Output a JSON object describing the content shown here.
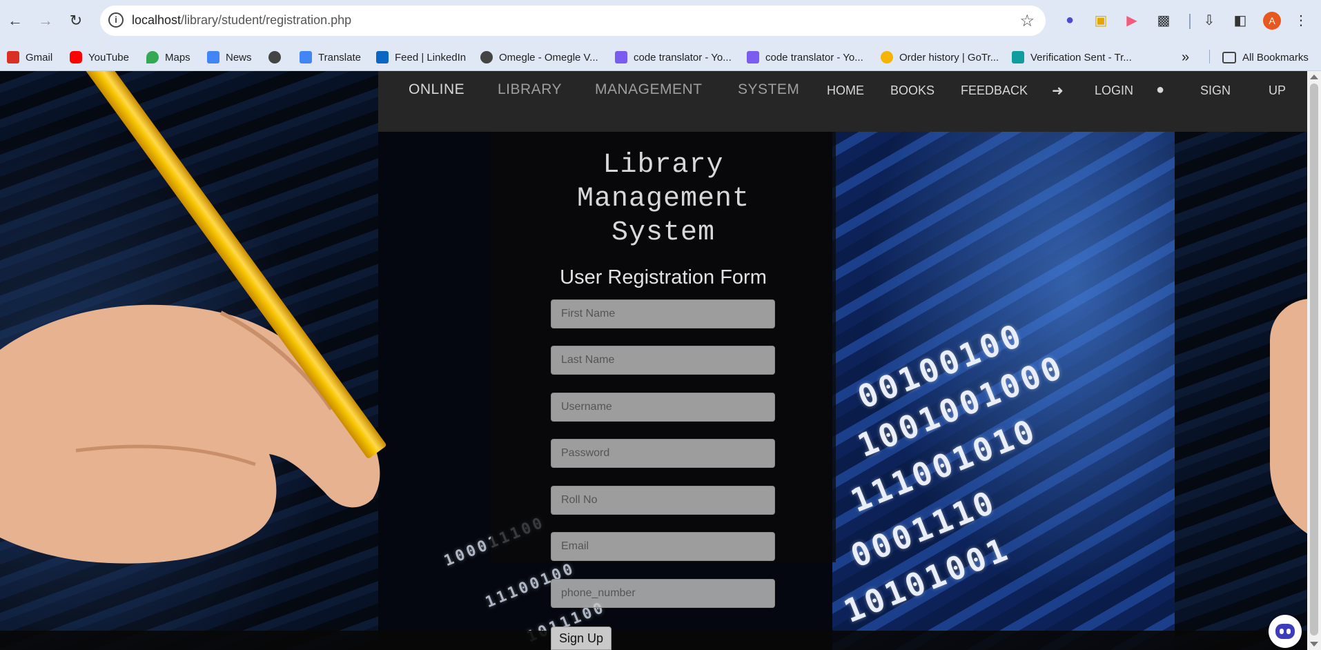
{
  "browser": {
    "url_host": "localhost",
    "url_path": "/library/student/registration.php",
    "profile_initial": "A",
    "bookmarks": [
      {
        "label": "Gmail",
        "icon": "gmail-icon",
        "color": "#d93025"
      },
      {
        "label": "YouTube",
        "icon": "youtube-icon",
        "color": "#ff0000"
      },
      {
        "label": "Maps",
        "icon": "maps-icon",
        "color": "#34a853"
      },
      {
        "label": "News",
        "icon": "news-icon",
        "color": "#4285f4"
      },
      {
        "label": "",
        "icon": "globe-icon",
        "color": "#333333"
      },
      {
        "label": "Translate",
        "icon": "translate-icon",
        "color": "#4285f4"
      },
      {
        "label": "Feed | LinkedIn",
        "icon": "linkedin-icon",
        "color": "#0a66c2"
      },
      {
        "label": "Omegle - Omegle V...",
        "icon": "globe-icon",
        "color": "#333333"
      },
      {
        "label": "code translator - Yo...",
        "icon": "app-icon",
        "color": "#7b5cf0"
      },
      {
        "label": "code translator - Yo...",
        "icon": "app-icon",
        "color": "#7b5cf0"
      },
      {
        "label": "Order history | GoTr...",
        "icon": "gotranscript-icon",
        "color": "#f4b400"
      },
      {
        "label": "Verification Sent - Tr...",
        "icon": "site-icon",
        "color": "#0f9d9d"
      }
    ],
    "all_bookmarks_label": "All Bookmarks"
  },
  "nav": {
    "brand": [
      "ONLINE",
      "LIBRARY",
      "MANAGEMENT",
      "SYSTEM"
    ],
    "home": "HOME",
    "books": "BOOKS",
    "feedback": "FEEDBACK",
    "login": "LOGIN",
    "sign": "SIGN",
    "up": "UP"
  },
  "page": {
    "title_line1": "Library",
    "title_line2": "Management",
    "title_line3": "System",
    "form_title": "User Registration Form"
  },
  "form": {
    "first_name_placeholder": "First Name",
    "last_name_placeholder": "Last Name",
    "username_placeholder": "Username",
    "password_placeholder": "Password",
    "roll_no_placeholder": "Roll No",
    "email_placeholder": "Email",
    "phone_placeholder": "phone_number",
    "submit_label": "Sign Up"
  },
  "background_text": {
    "binary_rows": [
      "00100100",
      "1001001000",
      "111001010",
      "0001110",
      "10101001",
      "100011100",
      "11100100",
      "1011100"
    ]
  }
}
